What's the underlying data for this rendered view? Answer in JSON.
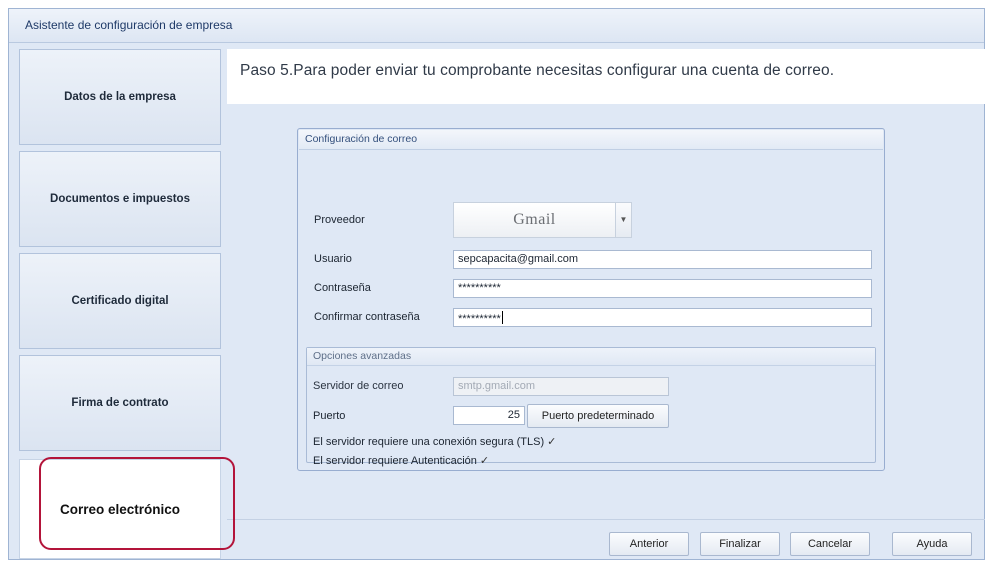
{
  "window": {
    "title": "Asistente de configuración de empresa"
  },
  "sidebar": {
    "items": [
      {
        "label": "Datos de la empresa"
      },
      {
        "label": "Documentos e impuestos"
      },
      {
        "label": "Certificado digital"
      },
      {
        "label": "Firma de contrato"
      },
      {
        "label": "Correo electrónico",
        "active": true
      }
    ]
  },
  "step": {
    "text": "Paso 5.Para poder enviar tu comprobante necesitas configurar una cuenta de correo."
  },
  "email_config": {
    "title": "Configuración de correo",
    "provider_label": "Proveedor",
    "provider_value": "Gmail",
    "user_label": "Usuario",
    "user_value": "sepcapacita@gmail.com",
    "password_label": "Contraseña",
    "password_value": "**********",
    "confirm_label": "Confirmar contraseña",
    "confirm_value": "**********"
  },
  "advanced": {
    "title": "Opciones avanzadas",
    "server_label": "Servidor de correo",
    "server_value": "smtp.gmail.com",
    "port_label": "Puerto",
    "port_value": "25",
    "default_port_button": "Puerto predeterminado",
    "tls_label": "El servidor requiere una conexión segura (TLS)",
    "tls_check": "✓",
    "auth_label": "El servidor requiere Autenticación",
    "auth_check": "✓"
  },
  "footer": {
    "prev": "Anterior",
    "finish": "Finalizar",
    "cancel": "Cancelar",
    "help": "Ayuda"
  },
  "colors": {
    "highlight": "#b3143a",
    "panel": "#dfe8f5",
    "accent": "#1f3a68"
  },
  "icons": {
    "dropdown": "chevron-down-icon",
    "check": "check-icon"
  }
}
